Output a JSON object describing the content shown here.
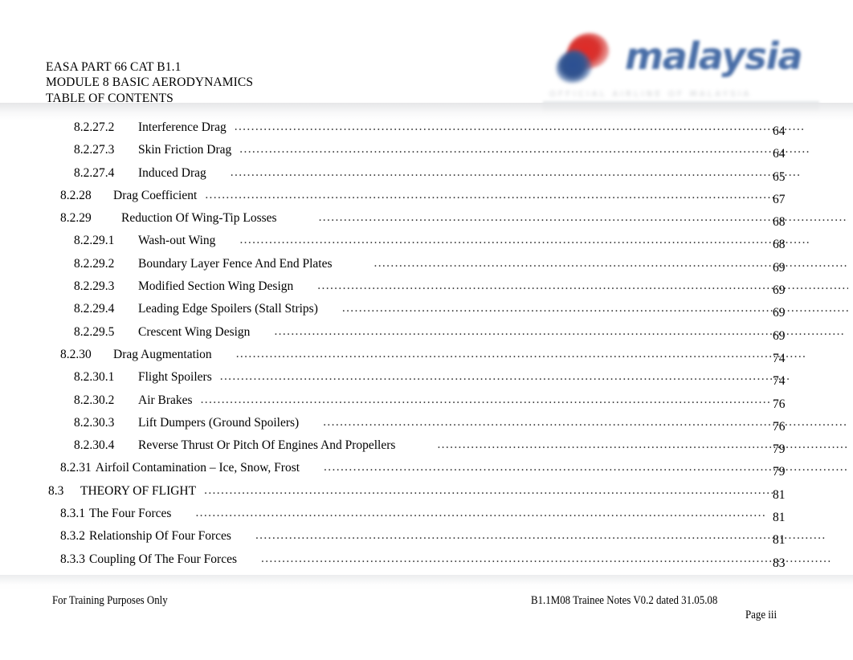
{
  "header": {
    "line1": "EASA PART 66 CAT B1.1",
    "line2": "MODULE 8 BASIC AERODYNAMICS",
    "line3": "TABLE OF CONTENTS"
  },
  "logo": {
    "wordmark": "malaysia",
    "subline": "OFFICIAL  AIRLINE  OF  MALAYSIA",
    "emblem_red": "#d8322e",
    "emblem_blue": "#2b4f93",
    "wordmark_color": "#3a62a0"
  },
  "toc": {
    "leader_dots": "........................................................................................................................................",
    "entries": [
      {
        "number": "8.2.27.2",
        "title": "Interference Drag",
        "page": "64",
        "level": 3,
        "gap": "sm"
      },
      {
        "number": "8.2.27.3",
        "title": "Skin Friction Drag",
        "page": "64",
        "level": 3,
        "gap": "sm"
      },
      {
        "number": "8.2.27.4",
        "title": "Induced Drag",
        "page": "65",
        "level": 3,
        "gap": "md"
      },
      {
        "number": "8.2.28",
        "title": "Drag Coefficient",
        "page": "67",
        "level": 2,
        "gap": "sm"
      },
      {
        "number": "8.2.29",
        "title": "Reduction Of Wing-Tip Losses",
        "page": "68",
        "level": 2,
        "gap": "lg"
      },
      {
        "number": "8.2.29.1",
        "title": "Wash-out Wing",
        "page": "68",
        "level": 3,
        "gap": "md"
      },
      {
        "number": "8.2.29.2",
        "title": "Boundary Layer Fence And End Plates",
        "page": "69",
        "level": 3,
        "gap": "lg"
      },
      {
        "number": "8.2.29.3",
        "title": "Modified Section Wing Design",
        "page": "69",
        "level": 3,
        "gap": "md"
      },
      {
        "number": "8.2.29.4",
        "title": "Leading Edge Spoilers (Stall Strips)",
        "page": "69",
        "level": 3,
        "gap": "md"
      },
      {
        "number": "8.2.29.5",
        "title": "Crescent Wing Design",
        "page": "69",
        "level": 3,
        "gap": "md"
      },
      {
        "number": "8.2.30",
        "title": "Drag Augmentation",
        "page": "74",
        "level": 2,
        "gap": "md"
      },
      {
        "number": "8.2.30.1",
        "title": "Flight Spoilers",
        "page": "74",
        "level": 3,
        "gap": "sm"
      },
      {
        "number": "8.2.30.2",
        "title": "Air Brakes",
        "page": "76",
        "level": 3,
        "gap": "sm"
      },
      {
        "number": "8.2.30.3",
        "title": "Lift Dumpers (Ground Spoilers)",
        "page": "76",
        "level": 3,
        "gap": "md"
      },
      {
        "number": "8.2.30.4",
        "title": "Reverse Thrust Or Pitch Of Engines And Propellers",
        "page": "79",
        "level": 3,
        "gap": "lg"
      },
      {
        "number": "8.2.31",
        "title": "Airfoil Contamination – Ice, Snow, Frost",
        "page": "79",
        "level": 2,
        "gap": "md",
        "inline": true
      },
      {
        "number": "8.3",
        "title": "THEORY OF FLIGHT",
        "page": "81",
        "level": 1,
        "gap": "sm"
      },
      {
        "number": "8.3.1",
        "title": "The Four Forces",
        "page": "81",
        "level": 2,
        "gap": "md",
        "inline": true
      },
      {
        "number": "8.3.2",
        "title": "Relationship Of Four Forces",
        "page": "81",
        "level": 2,
        "gap": "md",
        "inline": true
      },
      {
        "number": "8.3.3",
        "title": "Coupling Of The Four Forces",
        "page": "83",
        "level": 2,
        "gap": "md",
        "inline": true
      }
    ]
  },
  "footer": {
    "left": "For Training Purposes Only",
    "center": "B1.1M08 Trainee Notes V0.2 dated 31.05.08",
    "page_label": "Page iii"
  }
}
